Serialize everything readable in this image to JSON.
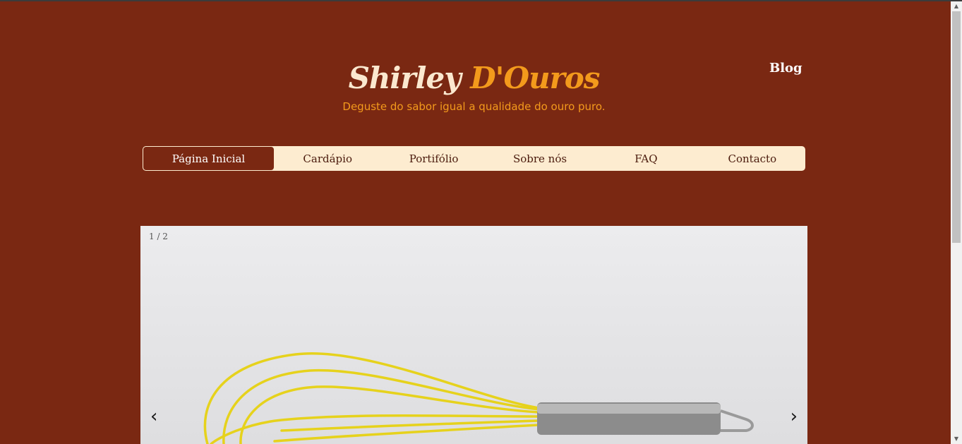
{
  "brand": {
    "first": "Shirley",
    "second": "D'Ouros",
    "tagline": "Deguste do sabor igual a qualidade do ouro puro."
  },
  "header": {
    "blog_label": "Blog"
  },
  "nav": {
    "items": [
      {
        "label": "Página Inicial"
      },
      {
        "label": "Cardápio"
      },
      {
        "label": "Portifólio"
      },
      {
        "label": "Sobre nós"
      },
      {
        "label": "FAQ"
      },
      {
        "label": "Contacto"
      }
    ]
  },
  "slider": {
    "counter": "1 / 2",
    "prev": "‹",
    "next": "›",
    "image_icon": "whisk-image"
  },
  "colors": {
    "background": "#7a2812",
    "accent": "#f39a1c",
    "brand_light": "#fbe8cf",
    "nav_bg": "#fdecd0"
  }
}
